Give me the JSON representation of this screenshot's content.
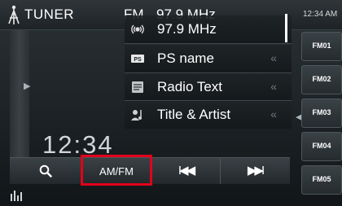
{
  "statusbar": {
    "source": "TUNER",
    "band": "FM",
    "frequency": "97.9 MHz",
    "clock": "12:34 AM"
  },
  "leftpanel": {
    "clock_big": "12:34"
  },
  "list": {
    "items": [
      {
        "label": "97.9 MHz",
        "icon": "broadcast-icon"
      },
      {
        "label": "PS name",
        "icon": "ps-icon"
      },
      {
        "label": "Radio Text",
        "icon": "radio-text-icon"
      },
      {
        "label": "Title & Artist",
        "icon": "title-artist-icon"
      }
    ],
    "chevron": "«"
  },
  "presets": [
    "FM01",
    "FM02",
    "FM03",
    "FM04",
    "FM05"
  ],
  "bottombar": {
    "search_icon": "search-icon",
    "amfm_label": "AM/FM",
    "prev_glyph": "I◀◀",
    "next_glyph": "▶▶I"
  },
  "colors": {
    "highlight": "#e2001a",
    "background": "#1b2124",
    "text": "#ffffff"
  }
}
